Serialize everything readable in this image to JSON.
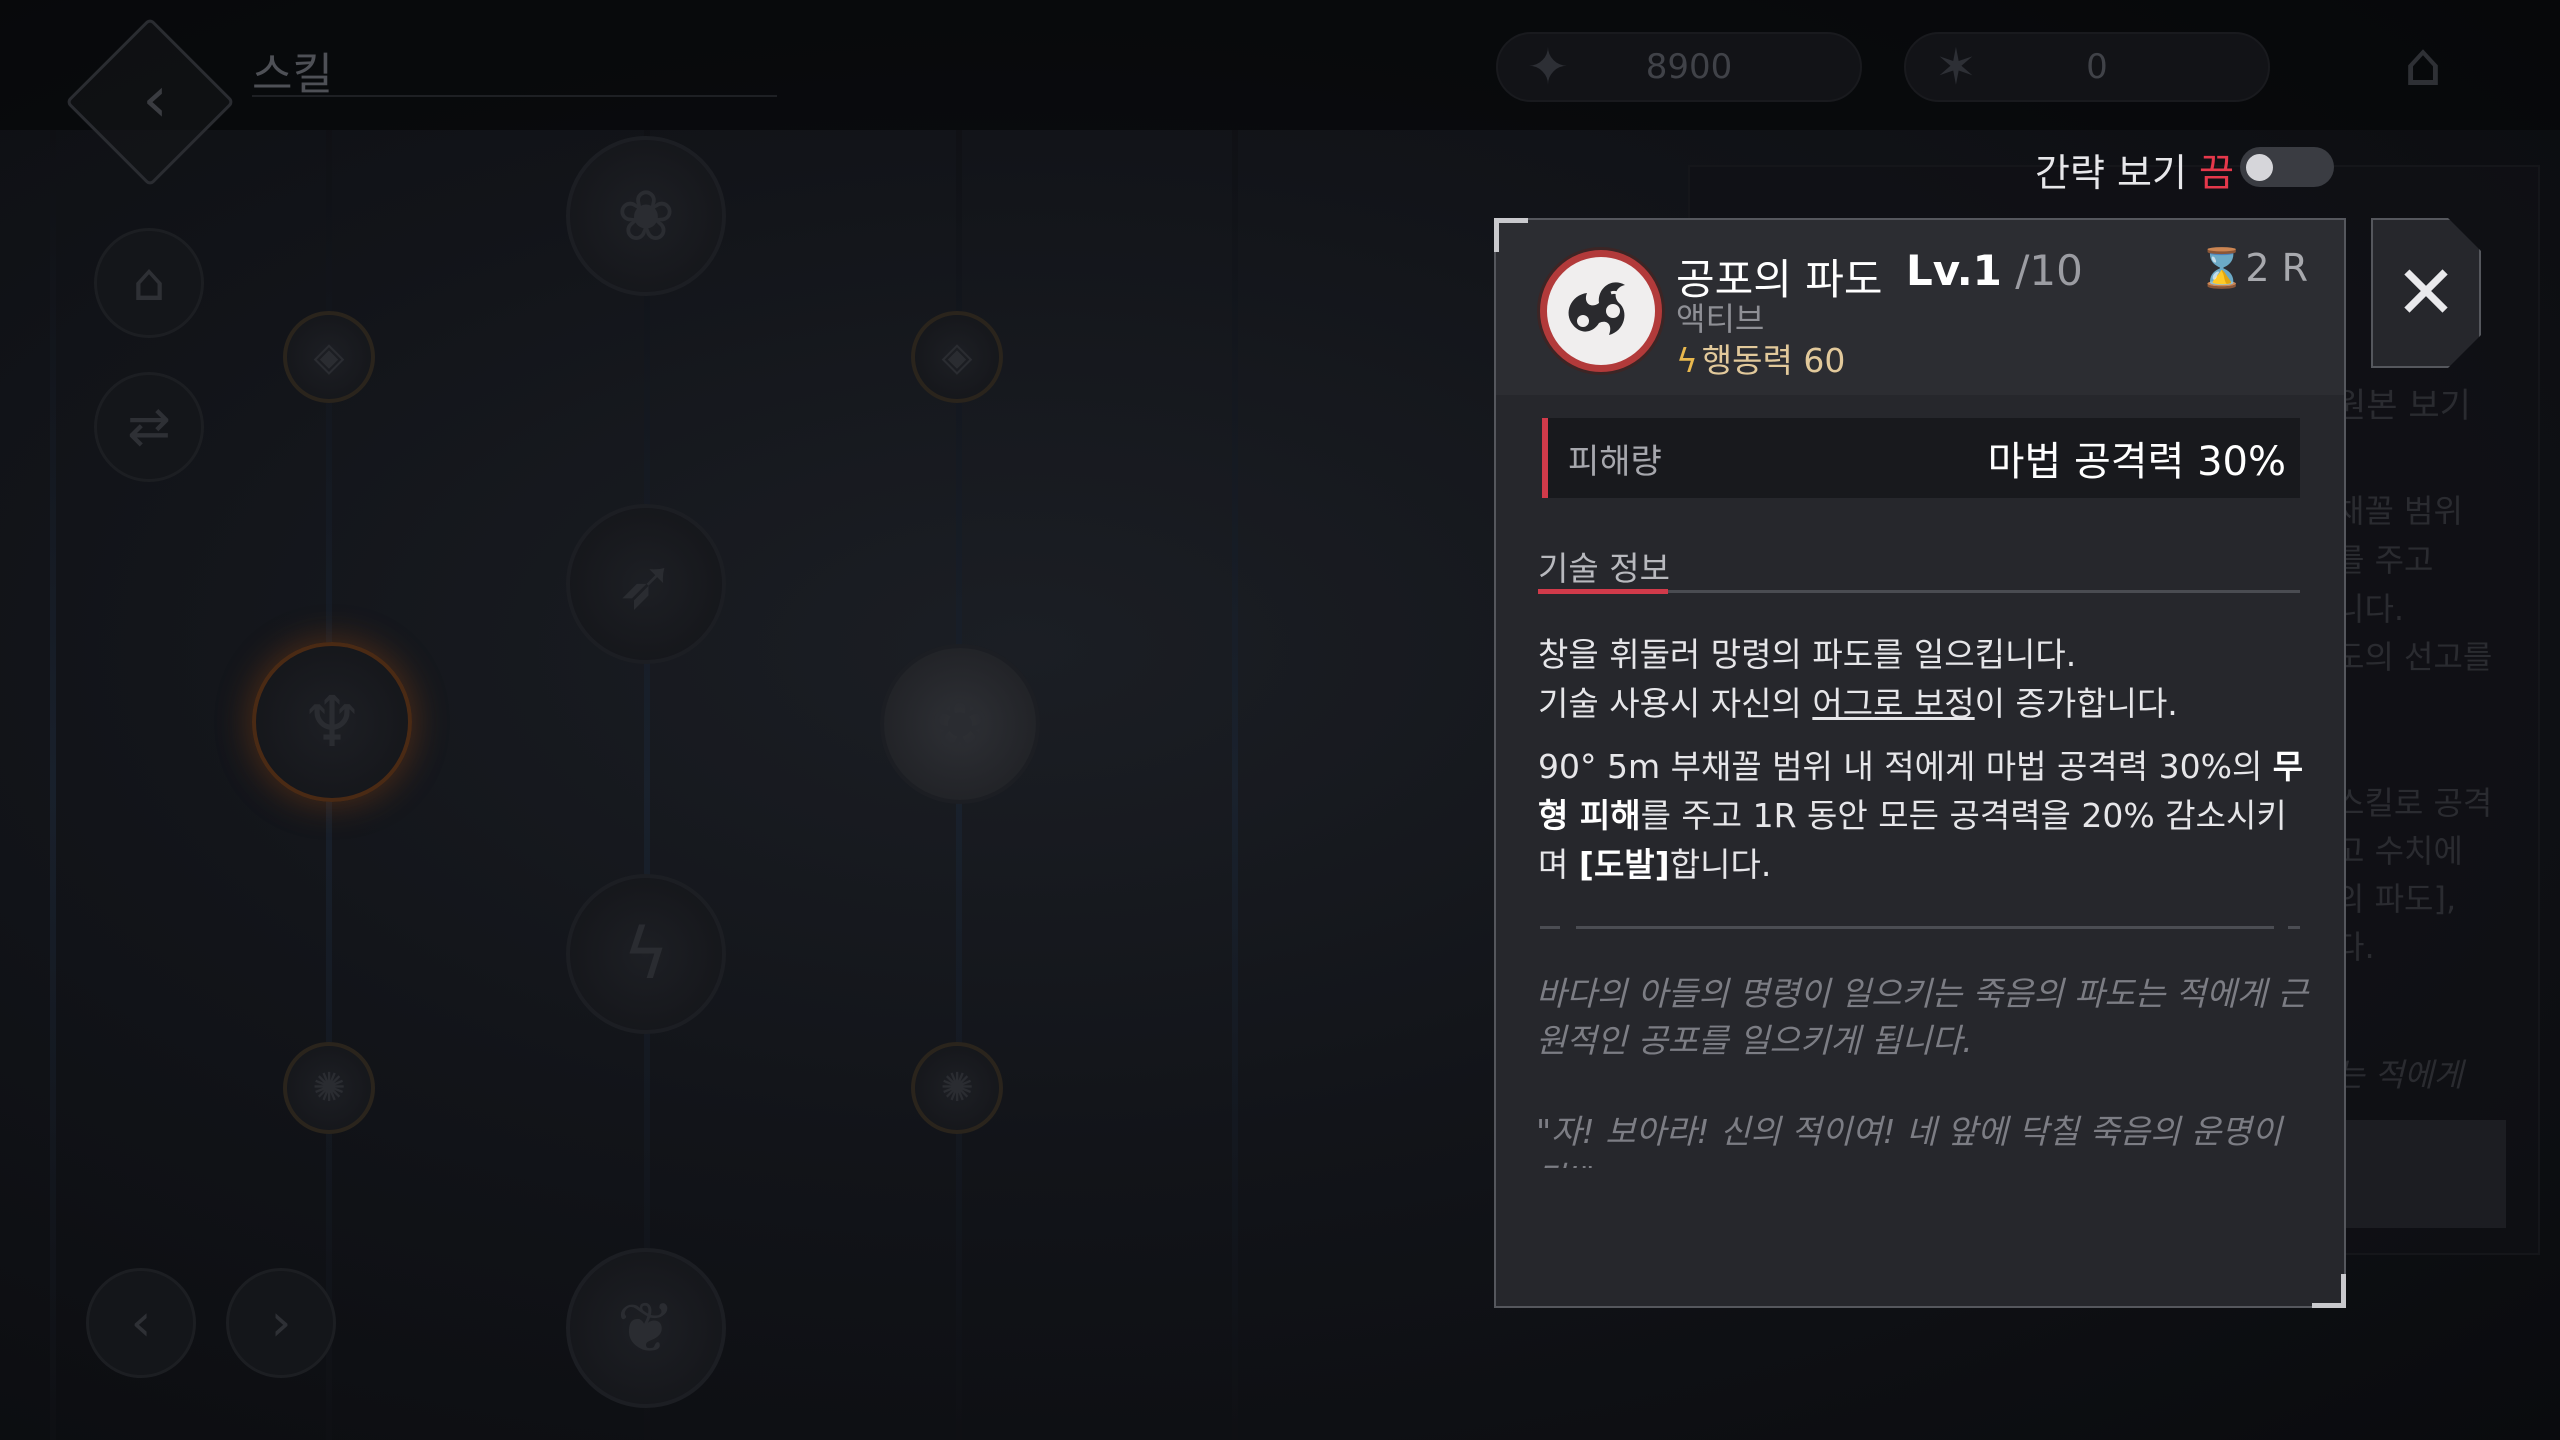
{
  "header": {
    "title": "스킬",
    "resources": [
      {
        "icon": "star-emblem-icon",
        "value": "8900"
      },
      {
        "icon": "demon-emblem-icon",
        "value": "0"
      }
    ]
  },
  "simple_view": {
    "label": "간략 보기",
    "state": "끔"
  },
  "dialog": {
    "skill_name": "공포의 파도",
    "level_current": "Lv.1",
    "level_max": "/10",
    "cooldown": "2 R",
    "type": "액티브",
    "action_point": "행동력 60",
    "damage": {
      "label": "피해량",
      "value": "마법 공격력 30%"
    },
    "info_tab": "기술 정보",
    "desc_line1": "창을 휘둘러 망령의 파도를 일으킵니다.",
    "desc_line2_pre": "기술 사용시 자신의 ",
    "desc_line2_link": "어그로 보정",
    "desc_line2_post": "이 증가합니다.",
    "desc_p2_pre": "90° 5m 부채꼴 범위 내 적에게 마법 공격력 30%의 ",
    "desc_p2_hl": "무형 피해",
    "desc_p2_mid": "를 주고 1R 동안 모든 공격력을 20% 감소시키며 ",
    "desc_p2_bold": "[도발]",
    "desc_p2_post": "합니다.",
    "lore1": "바다의 아들의 명령이 일으키는 죽음의 파도는 적에게 근원적인 공포를 일으키게 됩니다.",
    "lore2": "\"자! 보아라! 신의 적이여! 네 앞에 닥칠 죽음의 운명이다!\"",
    "close_label": "✕"
  },
  "background_ghost": {
    "tab": "원본 보기",
    "lines": [
      "채꼴 범위",
      "를 주고",
      "니다.",
      "도의 선고를",
      "스킬로 공격",
      "고 수치에",
      "의 파도],",
      "다.",
      "는 적에게"
    ]
  }
}
